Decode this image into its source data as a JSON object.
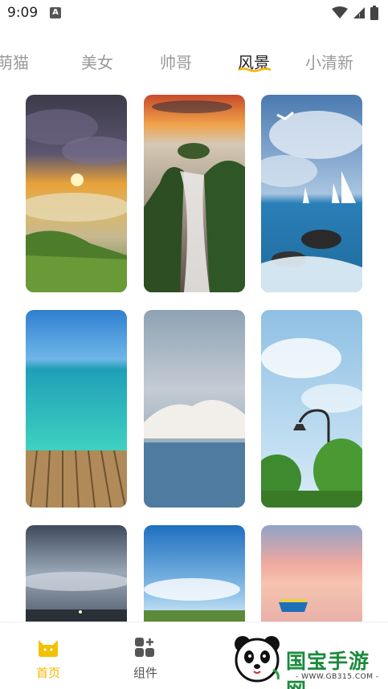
{
  "status_bar": {
    "time": "9:09",
    "notification_glyph": "A",
    "icons": [
      "wifi-icon",
      "signal-icon",
      "battery-icon"
    ]
  },
  "tabs": [
    {
      "label": "萌猫",
      "visible_text": "萌猫",
      "active": false
    },
    {
      "label": "美女",
      "active": false
    },
    {
      "label": "帅哥",
      "active": false
    },
    {
      "label": "风景",
      "active": true
    },
    {
      "label": "小清新",
      "active": false
    }
  ],
  "wallpapers": [
    {
      "name": "sunset-sea-of-clouds"
    },
    {
      "name": "rocky-waterfall-coast"
    },
    {
      "name": "sailboats-seagulls"
    },
    {
      "name": "turquoise-sea-pier"
    },
    {
      "name": "misty-mountain-lake"
    },
    {
      "name": "street-lamp-sky"
    },
    {
      "name": "dusky-clouds"
    },
    {
      "name": "blue-sky-meadow"
    },
    {
      "name": "pink-sunset-boat"
    }
  ],
  "bottom_nav": {
    "items": [
      {
        "label": "首页",
        "icon": "cat-icon",
        "active": true
      },
      {
        "label": "组件",
        "icon": "widgets-icon",
        "active": false
      }
    ]
  },
  "watermark": {
    "site_name": "国宝手游网",
    "url": "- WWW.GB315.COM -"
  },
  "colors": {
    "accent": "#f2b600",
    "tab_active": "#222222",
    "tab_inactive": "#9a9a9a",
    "watermark_green": "#1b8a3c"
  }
}
